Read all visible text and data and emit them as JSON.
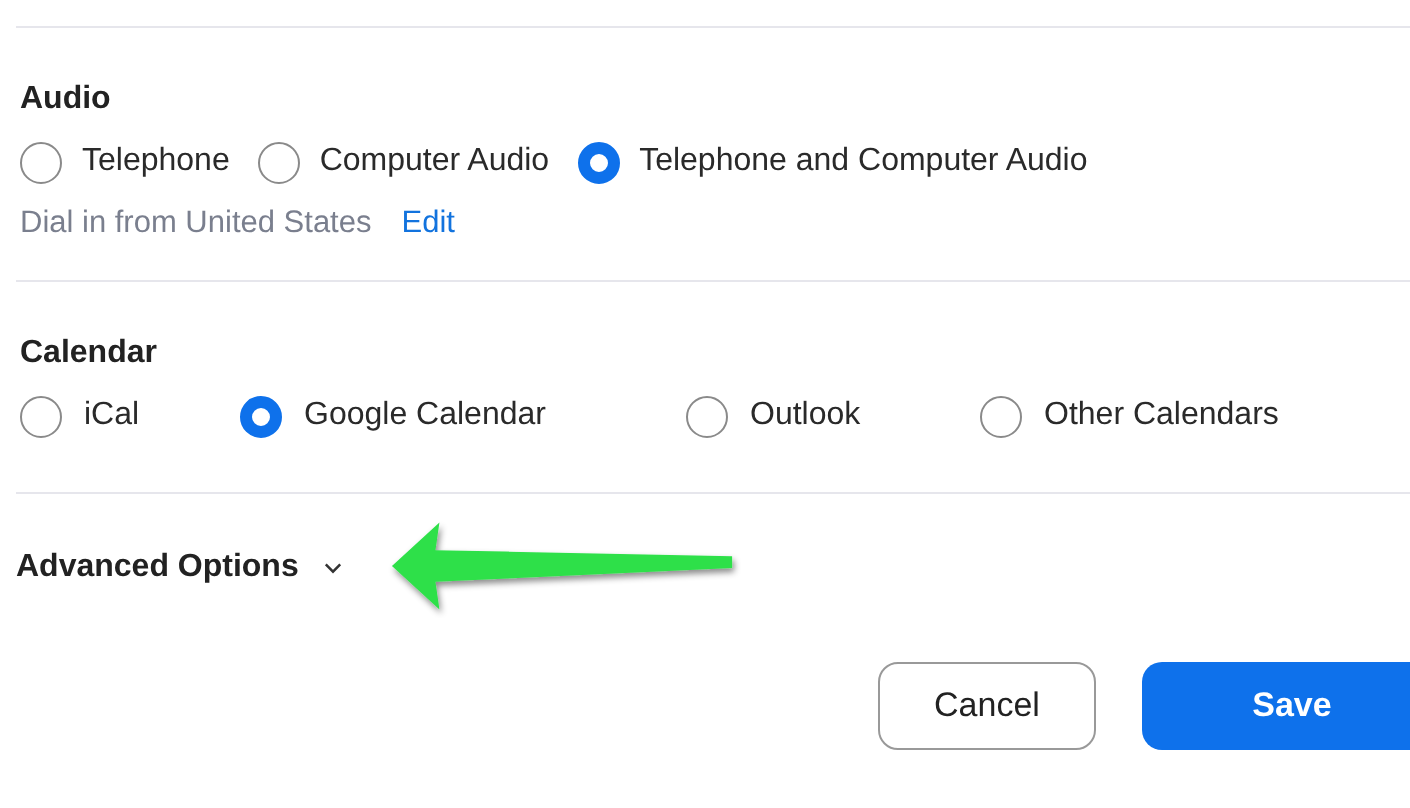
{
  "sections": [
    {
      "title": "Audio",
      "kind": "audio",
      "options": [
        {
          "label": "Telephone",
          "selected": false
        },
        {
          "label": "Computer Audio",
          "selected": false
        },
        {
          "label": "Telephone and Computer Audio",
          "selected": true
        }
      ],
      "note": {
        "text": "Dial in from United States",
        "link": "Edit"
      }
    },
    {
      "title": "Calendar",
      "kind": "calendar",
      "options": [
        {
          "label": "iCal",
          "selected": false
        },
        {
          "label": "Google Calendar",
          "selected": true
        },
        {
          "label": "Outlook",
          "selected": false
        },
        {
          "label": "Other Calendars",
          "selected": false
        }
      ]
    }
  ],
  "advanced": {
    "label": "Advanced Options",
    "expanded": false
  },
  "buttons": [
    {
      "label": "Cancel",
      "kind": "secondary"
    },
    {
      "label": "Save",
      "kind": "primary"
    }
  ]
}
